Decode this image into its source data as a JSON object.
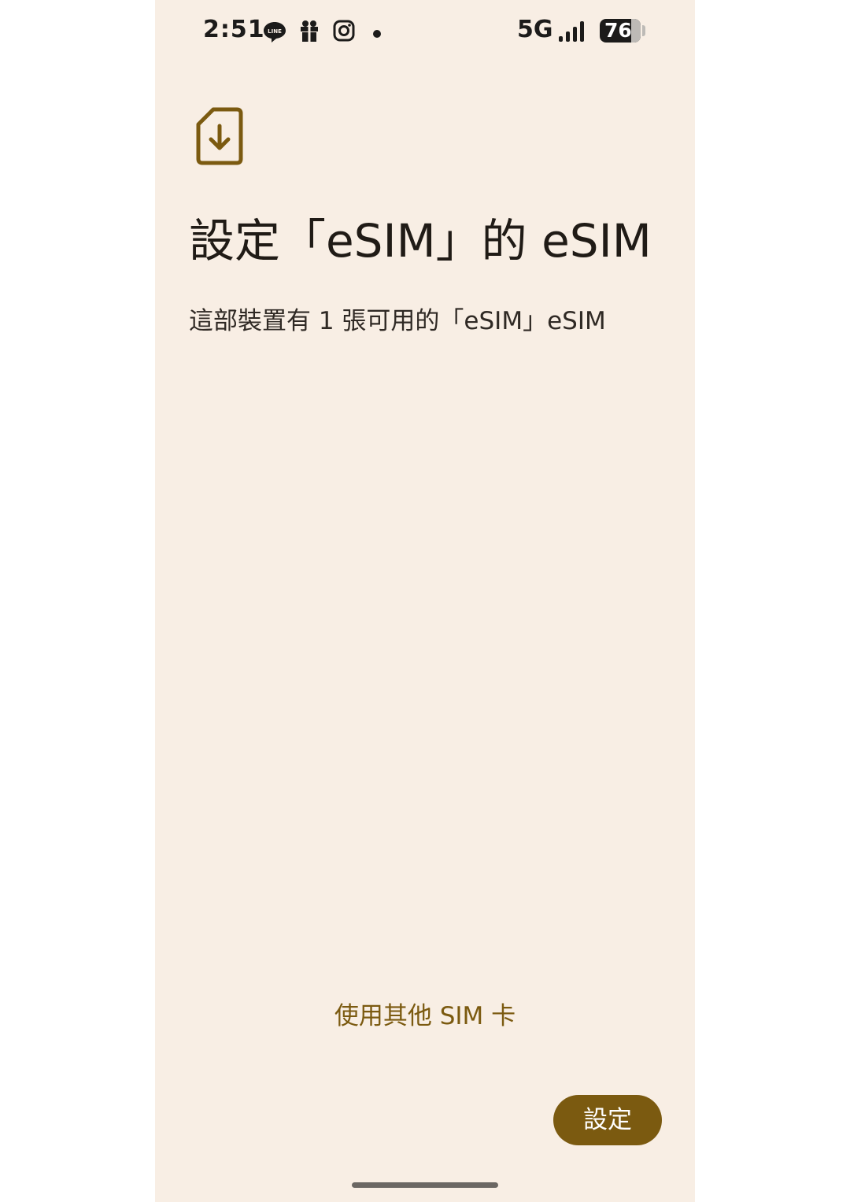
{
  "status_bar": {
    "time": "2:51",
    "network": "5G",
    "battery_level": "76",
    "battery_fraction": 0.76,
    "notification_icons": [
      "line-icon",
      "gift-icon",
      "instagram-icon",
      "dot-icon"
    ],
    "system_icons": [
      "signal-icon",
      "battery-icon"
    ]
  },
  "header": {
    "icon": "sim-download-icon",
    "title": "設定「eSIM」的 eSIM",
    "subtitle": "這部裝置有 1 張可用的「eSIM」eSIM"
  },
  "actions": {
    "other_sim_label": "使用其他 SIM 卡",
    "setup_label": "設定"
  },
  "colors": {
    "background": "#f8eee4",
    "accent": "#7b5a10",
    "text_primary": "#201b16"
  }
}
